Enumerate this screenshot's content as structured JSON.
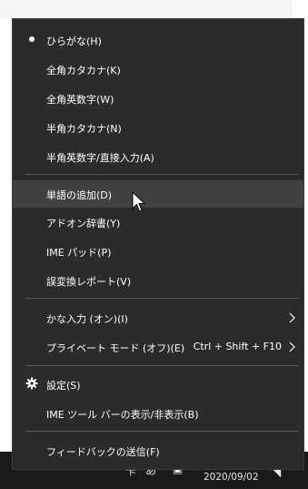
{
  "menu": {
    "items": [
      {
        "label": "ひらがな(H)",
        "checked": true
      },
      {
        "label": "全角カタカナ(K)"
      },
      {
        "label": "全角英数字(W)"
      },
      {
        "label": "半角カタカナ(N)"
      },
      {
        "label": "半角英数字/直接入力(A)"
      },
      {
        "label": "単語の追加(D)",
        "highlighted": true
      },
      {
        "label": "アドオン辞書(Y)"
      },
      {
        "label": "IME パッド(P)"
      },
      {
        "label": "誤変換レポート(V)"
      },
      {
        "label": "かな入力 (オン)(I)",
        "has_submenu": true
      },
      {
        "label": "プライベート モード (オフ)(E)",
        "shortcut": "Ctrl + Shift + F10",
        "has_submenu": true
      },
      {
        "label": "設定(S)",
        "icon": "gear-icon"
      },
      {
        "label": "IME ツール バーの表示/非表示(B)"
      },
      {
        "label": "フィードバックの送信(F)"
      }
    ]
  },
  "taskbar": {
    "date": "2020/09/02"
  },
  "colors": {
    "menu_bg": "#2b2b2b",
    "highlight": "#414141",
    "separator": "#5a5a5a",
    "text": "#ffffff",
    "taskbar": "#1a1a1a"
  }
}
